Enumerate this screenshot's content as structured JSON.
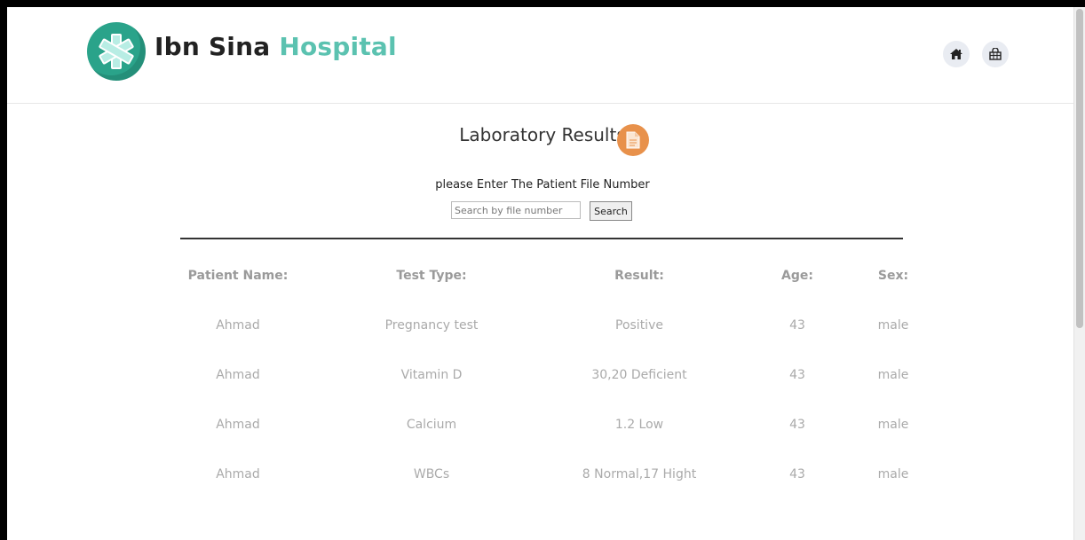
{
  "header": {
    "brand_part1": "Ibn Sina",
    "brand_part2": "Hospital",
    "logo_icon": "medical-star-icon",
    "nav_icons": [
      "home-icon",
      "basket-icon"
    ]
  },
  "main": {
    "title": "Laboratory Results",
    "title_icon": "document-icon",
    "prompt": "please Enter The Patient File Number",
    "search": {
      "placeholder": "Search by file number",
      "value": "",
      "button_label": "Search"
    }
  },
  "table": {
    "columns": [
      "Patient Name:",
      "Test Type:",
      "Result:",
      "Age:",
      "Sex:"
    ],
    "rows": [
      [
        "Ahmad",
        "Pregnancy test",
        "Positive",
        "43",
        "male"
      ],
      [
        "Ahmad",
        "Vitamin D",
        "30,20 Deficient",
        "43",
        "male"
      ],
      [
        "Ahmad",
        "Calcium",
        "1.2 Low",
        "43",
        "male"
      ],
      [
        "Ahmad",
        "WBCs",
        "8 Normal,17 Hight",
        "43",
        "male"
      ]
    ]
  },
  "colors": {
    "brand_accent": "#5bc2b0",
    "logo": "#2aa38a",
    "doc_icon": "#e8914b"
  }
}
